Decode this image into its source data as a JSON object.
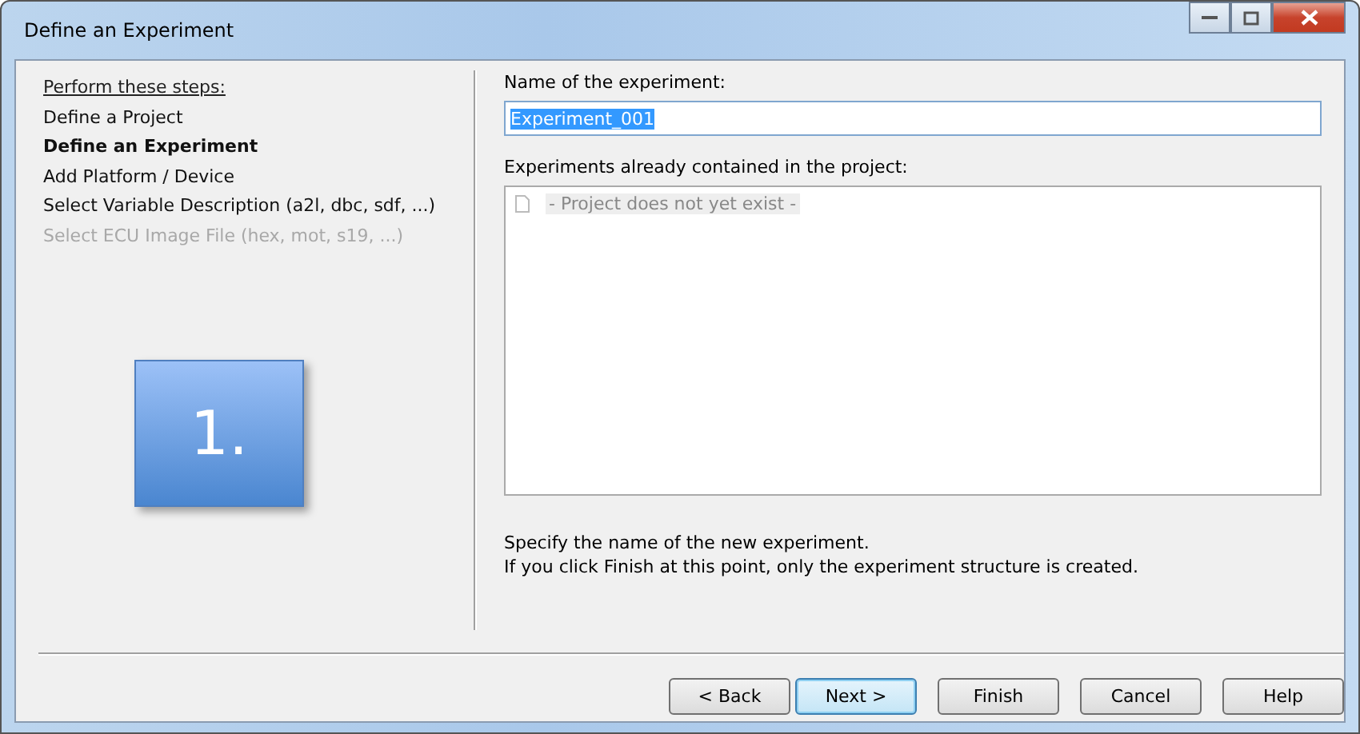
{
  "window": {
    "title": "Define an Experiment"
  },
  "steps": {
    "heading": "Perform these steps:",
    "items": [
      {
        "label": "Define a Project",
        "selected": false,
        "disabled": false
      },
      {
        "label": "Define an Experiment",
        "selected": true,
        "disabled": false
      },
      {
        "label": "Add Platform / Device",
        "selected": false,
        "disabled": false
      },
      {
        "label": "Select Variable Description (a2l, dbc, sdf, ...)",
        "selected": false,
        "disabled": false
      },
      {
        "label": "Select ECU Image File (hex, mot, s19, ...)",
        "selected": false,
        "disabled": true
      }
    ],
    "step_badge": "1."
  },
  "name_field": {
    "label": "Name of the experiment:",
    "value": "Experiment_001"
  },
  "experiments_list": {
    "label": "Experiments already contained in the project:",
    "items": [
      "- Project does not yet exist -"
    ]
  },
  "description": [
    "Specify the name of the new experiment.",
    "If you click Finish at this point, only the experiment structure is created."
  ],
  "buttons": [
    {
      "label": "< Back",
      "selected": false
    },
    {
      "label": "Next >",
      "selected": true
    },
    {
      "label": "Finish",
      "selected": false
    },
    {
      "label": "Cancel",
      "selected": false
    },
    {
      "label": "Help",
      "selected": false
    }
  ]
}
